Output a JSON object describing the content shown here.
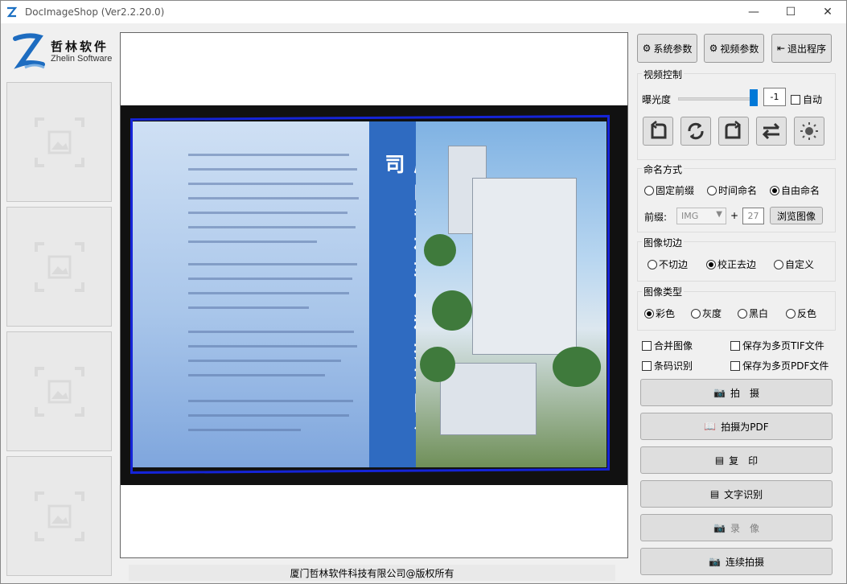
{
  "window": {
    "title": "DocImageShop  (Ver2.2.20.0)"
  },
  "logo": {
    "name_cn": "哲林软件",
    "name_en": "Zhelin Software"
  },
  "toolbar": {
    "system_params": "系统参数",
    "video_params": "视频参数",
    "exit": "退出程序"
  },
  "video_control": {
    "title": "视频控制",
    "exposure_label": "曝光度",
    "exposure_value": "-1",
    "auto_label": "自动",
    "auto_checked": false,
    "icons": [
      "rotate-left-icon",
      "refresh-icon",
      "rotate-right-icon",
      "swap-icon",
      "brightness-icon"
    ]
  },
  "naming": {
    "title": "命名方式",
    "options": [
      "固定前缀",
      "时间命名",
      "自由命名"
    ],
    "selected": "自由命名",
    "prefix_label": "前缀:",
    "prefix_value": "IMG",
    "plus": "+",
    "number_value": "27",
    "browse_button": "浏览图像"
  },
  "crop": {
    "title": "图像切边",
    "options": [
      "不切边",
      "校正去边",
      "自定义"
    ],
    "selected": "校正去边"
  },
  "image_type": {
    "title": "图像类型",
    "options": [
      "彩色",
      "灰度",
      "黑白",
      "反色"
    ],
    "selected": "彩色"
  },
  "checkboxes": {
    "merge": "合并图像",
    "save_tif": "保存为多页TIF文件",
    "barcode": "条码识别",
    "save_pdf": "保存为多页PDF文件"
  },
  "actions": {
    "capture": "拍　摄",
    "capture_pdf": "拍摄为PDF",
    "copy": "复　印",
    "ocr": "文字识别",
    "record": "录　像",
    "continuous": "连续拍摄"
  },
  "preview": {
    "doc_heading": "厦门哲林软件科技有限公司"
  },
  "footer": {
    "copyright": "厦门哲林软件科技有限公司@版权所有"
  }
}
